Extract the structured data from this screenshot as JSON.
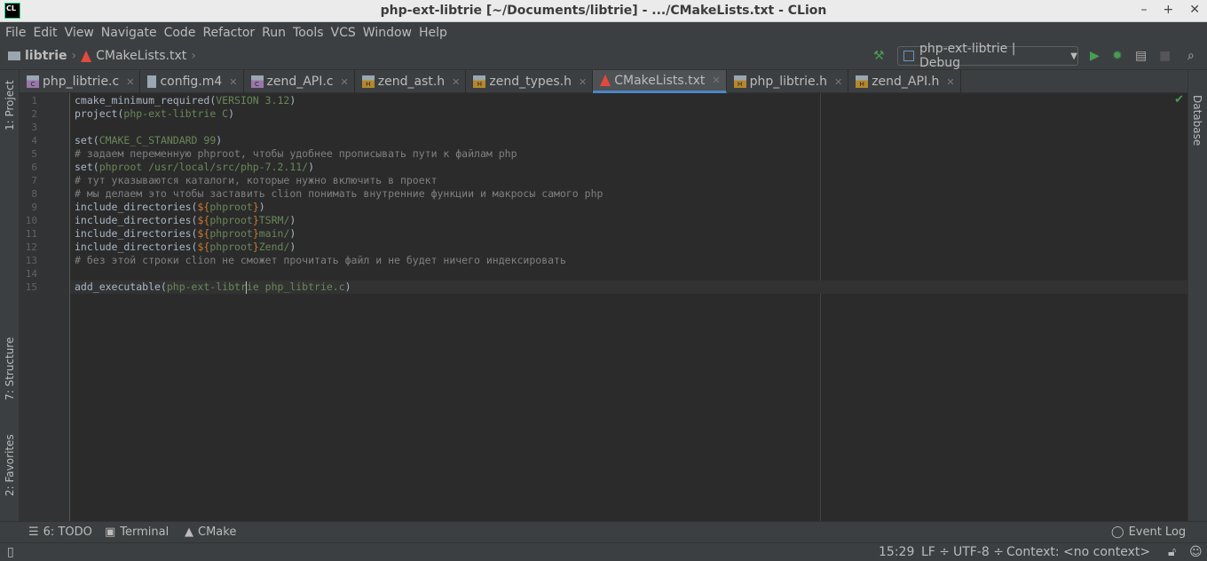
{
  "window": {
    "title": "php-ext-libtrie [~/Documents/libtrie] - .../CMakeLists.txt - CLion",
    "logo": "CL",
    "controls": [
      "–",
      "+",
      "✕"
    ]
  },
  "menu": [
    "File",
    "Edit",
    "View",
    "Navigate",
    "Code",
    "Refactor",
    "Run",
    "Tools",
    "VCS",
    "Window",
    "Help"
  ],
  "breadcrumb": {
    "project": "libtrie",
    "file": "CMakeLists.txt"
  },
  "run_config": "php-ext-libtrie | Debug",
  "tabs": [
    {
      "label": "php_libtrie.c",
      "icon": "c"
    },
    {
      "label": "config.m4",
      "icon": "f"
    },
    {
      "label": "zend_API.c",
      "icon": "c"
    },
    {
      "label": "zend_ast.h",
      "icon": "h"
    },
    {
      "label": "zend_types.h",
      "icon": "h"
    },
    {
      "label": "CMakeLists.txt",
      "icon": "cmake",
      "active": true
    },
    {
      "label": "php_libtrie.h",
      "icon": "h"
    },
    {
      "label": "zend_API.h",
      "icon": "h"
    }
  ],
  "left_tools": {
    "project": "1: Project",
    "structure": "7: Structure",
    "favorites": "2: Favorites"
  },
  "right_tools": {
    "database": "Database"
  },
  "code": [
    [
      [
        "cmake_minimum_required(",
        ""
      ],
      [
        "VERSION 3.12",
        "s"
      ],
      [
        ")",
        ""
      ]
    ],
    [
      [
        "project(",
        ""
      ],
      [
        "php-ext-libtrie C",
        "s"
      ],
      [
        ")",
        ""
      ]
    ],
    [],
    [
      [
        "set(",
        ""
      ],
      [
        "CMAKE_C_STANDARD 99",
        "s"
      ],
      [
        ")",
        ""
      ]
    ],
    [
      [
        "# задаем переменную phproot, чтобы удобнее прописывать пути к файлам php",
        "c"
      ]
    ],
    [
      [
        "set(",
        ""
      ],
      [
        "phproot /usr/local/src/php-7.2.11/",
        "s"
      ],
      [
        ")",
        ""
      ]
    ],
    [
      [
        "# тут указываются каталоги, которые нужно включить в проект",
        "c"
      ]
    ],
    [
      [
        "# мы делаем это чтобы заставить clion понимать внутренние функции и макросы самого php",
        "c"
      ]
    ],
    [
      [
        "include_directories(",
        ""
      ],
      [
        "${",
        "v"
      ],
      [
        "phproot",
        "s"
      ],
      [
        "}",
        "v"
      ],
      [
        ")",
        ""
      ]
    ],
    [
      [
        "include_directories(",
        ""
      ],
      [
        "${",
        "v"
      ],
      [
        "phproot",
        "s"
      ],
      [
        "}",
        "v"
      ],
      [
        "TSRM/",
        "s"
      ],
      [
        ")",
        ""
      ]
    ],
    [
      [
        "include_directories(",
        ""
      ],
      [
        "${",
        "v"
      ],
      [
        "phproot",
        "s"
      ],
      [
        "}",
        "v"
      ],
      [
        "main/",
        "s"
      ],
      [
        ")",
        ""
      ]
    ],
    [
      [
        "include_directories(",
        ""
      ],
      [
        "${",
        "v"
      ],
      [
        "phproot",
        "s"
      ],
      [
        "}",
        "v"
      ],
      [
        "Zend/",
        "s"
      ],
      [
        ")",
        ""
      ]
    ],
    [
      [
        "# без этой строки clion не сможет прочитать файл и не будет ничего индексировать",
        "c"
      ]
    ],
    [],
    [
      [
        "add_executable(",
        ""
      ],
      [
        "php-ext-libtr",
        "s"
      ],
      [
        "|caret",
        ""
      ],
      [
        "ie php_libtrie.c",
        "s"
      ],
      [
        ")",
        ""
      ]
    ]
  ],
  "current_line": 15,
  "bottom_tools": {
    "todo": "6: TODO",
    "terminal": "Terminal",
    "cmake": "CMake",
    "event_log": "Event Log"
  },
  "status": {
    "position": "15:29",
    "line_sep": "LF ÷",
    "encoding": "UTF-8 ÷",
    "context": "Context: <no context>"
  },
  "colors": {
    "accent": "#4a88c7",
    "run": "#499c54",
    "editor_bg": "#2b2b2b"
  }
}
